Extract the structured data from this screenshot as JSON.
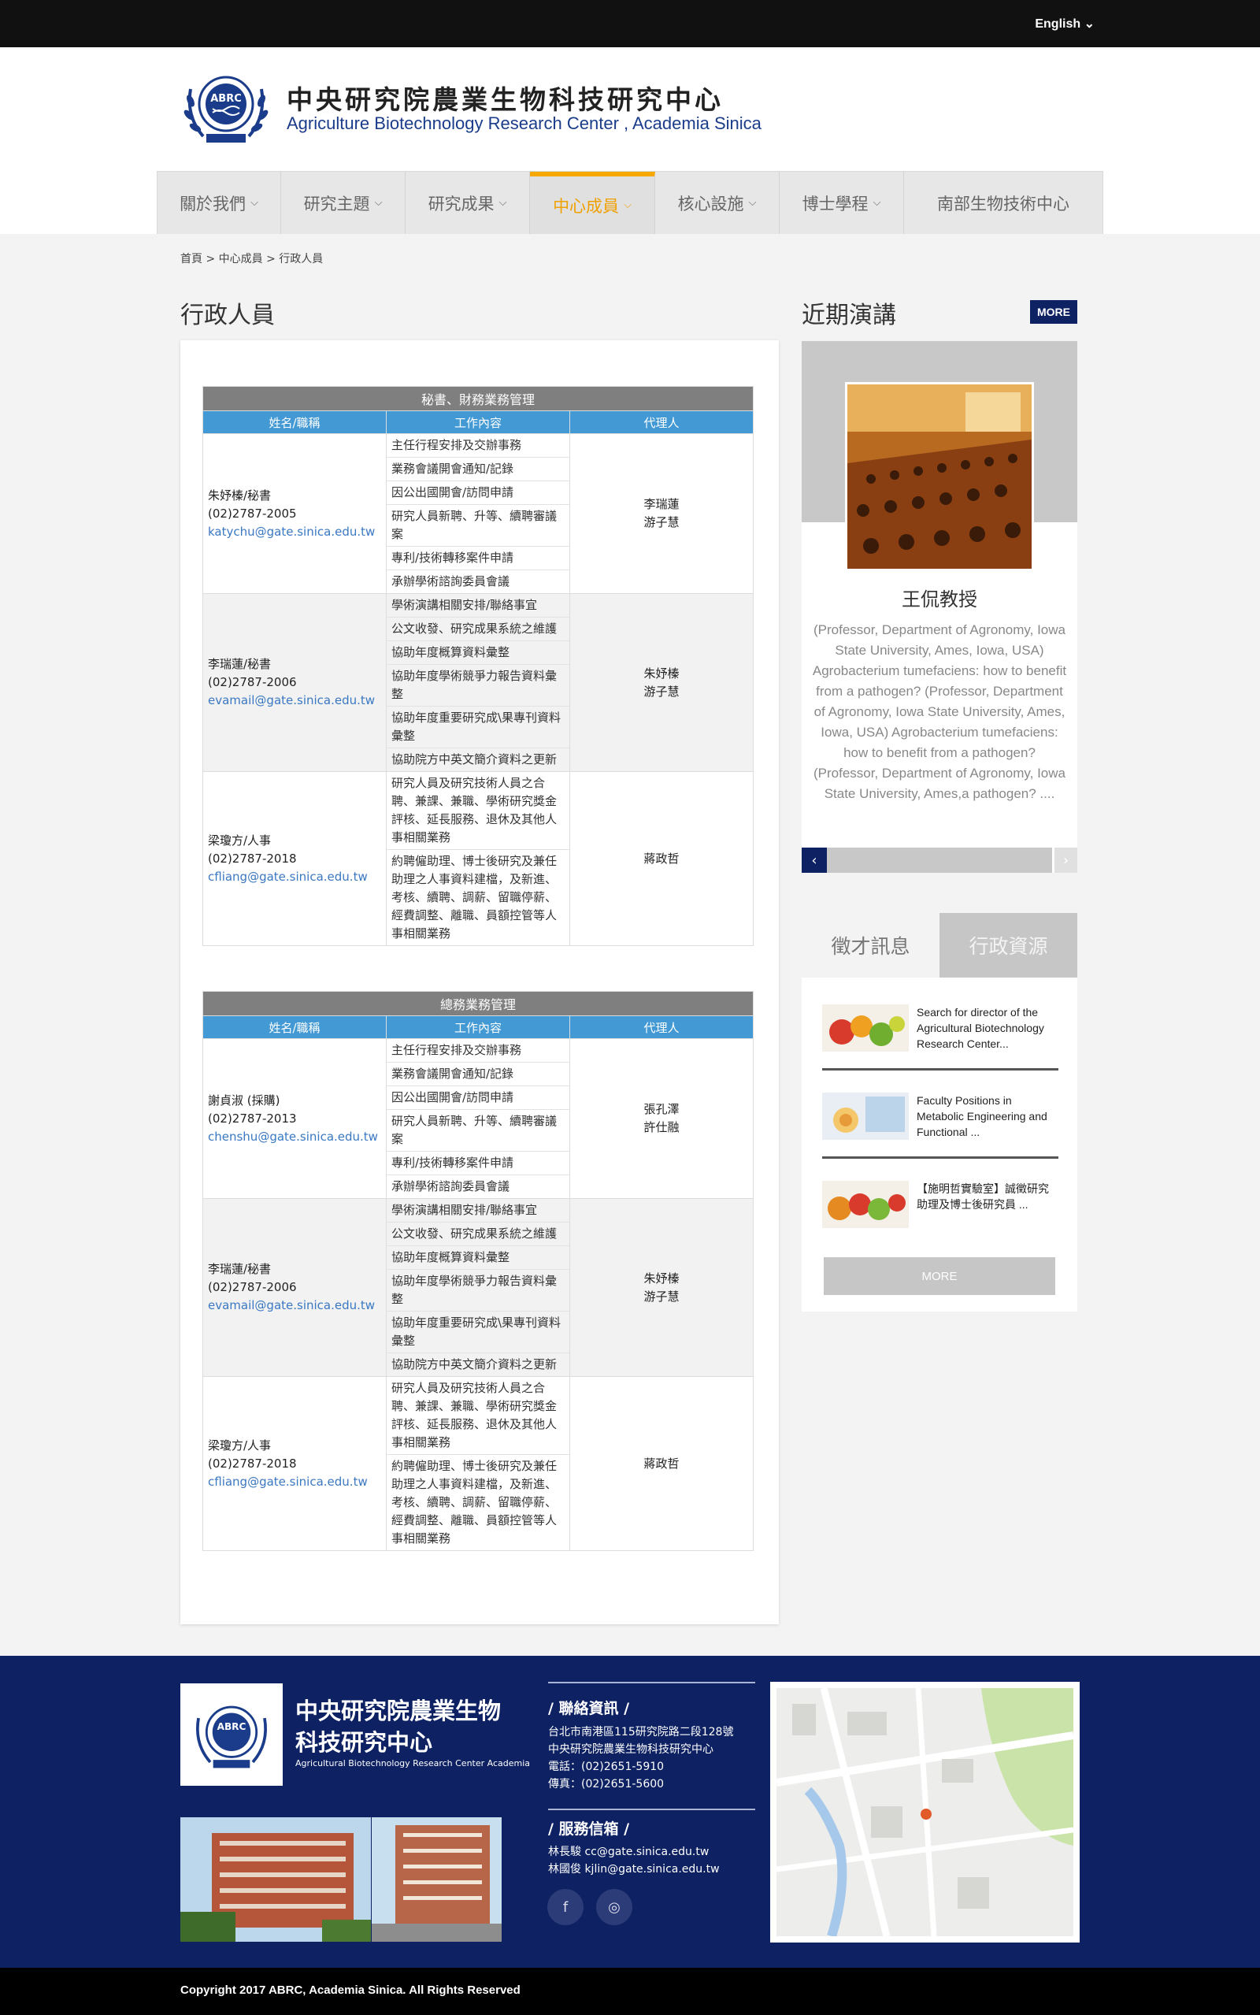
{
  "topbar": {
    "language": "English"
  },
  "logo": {
    "name_zh": "中央研究院農業生物科技研究中心",
    "name_en": "Agriculture Biotechnology Research Center , Academia Sinica",
    "seal_top": "ABRC",
    "seal_bottom": "ACADEMIA SINICA"
  },
  "nav": [
    {
      "label": "關於我們",
      "dropdown": true
    },
    {
      "label": "研究主題",
      "dropdown": true
    },
    {
      "label": "研究成果",
      "dropdown": true
    },
    {
      "label": "中心成員",
      "dropdown": true,
      "active": true
    },
    {
      "label": "核心設施",
      "dropdown": true
    },
    {
      "label": "博士學程",
      "dropdown": true
    },
    {
      "label": "南部生物技術中心",
      "dropdown": false
    }
  ],
  "breadcrumb": {
    "home": "首頁",
    "sep1": ">",
    "level1": "中心成員",
    "sep2": ">",
    "current": "行政人員"
  },
  "page_title": "行政人員",
  "table_headers": {
    "name": "姓名/職稱",
    "work": "工作內容",
    "deputy": "代理人"
  },
  "sections": [
    {
      "title": "秘書、財務業務管理",
      "rows": [
        {
          "name": "朱妤榛/秘書",
          "phone": "(02)2787-2005",
          "email": "katychu@gate.sinica.edu.tw",
          "duties": [
            "主任行程安排及交辦事務",
            "業務會議開會通知/記錄",
            "因公出國開會/訪問申請",
            "研究人員新聘、升等、續聘審議案",
            "專利/技術轉移案件申請",
            "承辦學術諮詢委員會議"
          ],
          "deputy": [
            "李瑞蓮",
            "游子慧"
          ]
        },
        {
          "name": "李瑞蓮/秘書",
          "phone": "(02)2787-2006",
          "email": "evamail@gate.sinica.edu.tw",
          "duties": [
            "學術演講相關安排/聯絡事宜",
            "公文收發、研究成果系統之維護",
            "協助年度概算資料彙整",
            "協助年度學術競爭力報告資料彙整",
            "協助年度重要研究成\\果專刊資料彙整",
            "協助院方中英文簡介資料之更新"
          ],
          "deputy": [
            "朱妤榛",
            "游子慧"
          ]
        },
        {
          "name": "梁瓊方/人事",
          "phone": "(02)2787-2018",
          "email": "cfliang@gate.sinica.edu.tw",
          "duties": [
            "研究人員及研究技術人員之合聘、兼課、兼職、學術研究獎金評核、延長服務、退休及其他人事相關業務",
            "約聘僱助理、博士後研究及兼任助理之人事資料建檔，及新進、考核、續聘、調薪、留職停薪、經費調整、離職、員額控管等人事相關業務"
          ],
          "deputy": [
            "蔣政哲"
          ]
        }
      ]
    },
    {
      "title": "總務業務管理",
      "rows": [
        {
          "name": "謝貞淑 (採購)",
          "phone": "(02)2787-2013",
          "email": "chenshu@gate.sinica.edu.tw",
          "duties": [
            "主任行程安排及交辦事務",
            "業務會議開會通知/記錄",
            "因公出國開會/訪問申請",
            "研究人員新聘、升等、續聘審議案",
            "專利/技術轉移案件申請",
            "承辦學術諮詢委員會議"
          ],
          "deputy": [
            "張孔澤",
            "許仕融"
          ]
        },
        {
          "name": "李瑞蓮/秘書",
          "phone": "(02)2787-2006",
          "email": "evamail@gate.sinica.edu.tw",
          "duties": [
            "學術演講相關安排/聯絡事宜",
            "公文收發、研究成果系統之維護",
            "協助年度概算資料彙整",
            "協助年度學術競爭力報告資料彙整",
            "協助年度重要研究成\\果專刊資料彙整",
            "協助院方中英文簡介資料之更新"
          ],
          "deputy": [
            "朱妤榛",
            "游子慧"
          ]
        },
        {
          "name": "梁瓊方/人事",
          "phone": "(02)2787-2018",
          "email": "cfliang@gate.sinica.edu.tw",
          "duties": [
            "研究人員及研究技術人員之合聘、兼課、兼職、學術研究獎金評核、延長服務、退休及其他人事相關業務",
            "約聘僱助理、博士後研究及兼任助理之人事資料建檔，及新進、考核、續聘、調薪、留職停薪、經費調整、離職、員額控管等人事相關業務"
          ],
          "deputy": [
            "蔣政哲"
          ]
        }
      ]
    }
  ],
  "sidebar": {
    "title": "近期演講",
    "more": "MORE",
    "talk_name": "王侃教授",
    "talk_desc": "(Professor, Department of Agronomy, Iowa State University, Ames, Iowa, USA) Agrobacterium tumefaciens: how to benefit from a pathogen? (Professor, Department of Agronomy, Iowa State University, Ames, Iowa, USA) Agrobacterium tumefaciens: how to benefit from a pathogen? (Professor, Department of Agronomy, Iowa State University, Ames,a pathogen? ....",
    "prev_icon": "‹",
    "next_icon": "›"
  },
  "tabs": {
    "tab1": "徵才訊息",
    "tab2": "行政資源",
    "jobs": [
      {
        "text": "Search for director of the Agricultural Biotechnology Research Center..."
      },
      {
        "text": "Faculty Positions in Metabolic Engineering and Functional  ..."
      },
      {
        "text": "【施明哲實驗室】誠徵研究助理及博士後研究員 ..."
      }
    ],
    "more": "MORE"
  },
  "footer": {
    "name_zh": "中央研究院農業生物科技研究中心",
    "name_en": "Agricultural Biotechnology Research Center Academia",
    "contact_title": "/ 聯絡資訊 /",
    "address": "台北市南港區115研究院路二段128號",
    "org": "中央研究院農業生物科技研究中心",
    "tel": "電話：(02)2651-5910",
    "fax": "傳真：(02)2651-5600",
    "mail_title": "/ 服務信箱 /",
    "mail1": "林長駿  cc@gate.sinica.edu.tw",
    "mail2": "林國俊  kjlin@gate.sinica.edu.tw",
    "facebook": "f",
    "instagram": "◎"
  },
  "copyright": "Copyright 2017 ABRC, Academia Sinica. All Rights Reserved"
}
